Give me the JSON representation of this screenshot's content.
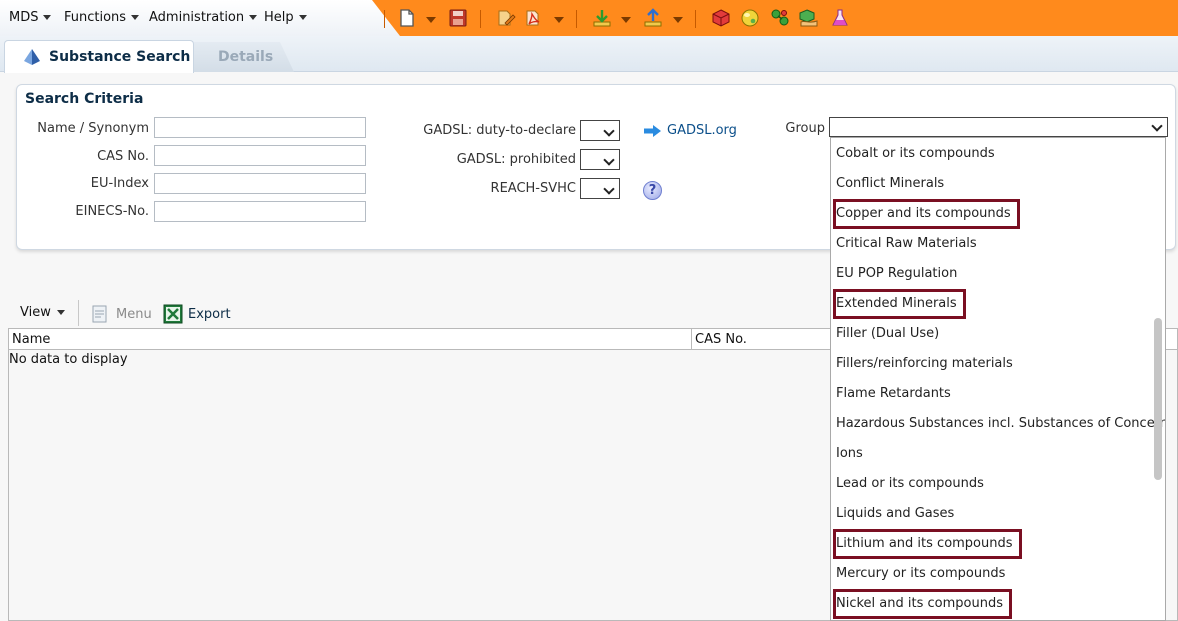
{
  "menubar": {
    "items": [
      "MDS",
      "Functions",
      "Administration",
      "Help"
    ]
  },
  "toolbar_icons": [
    "new-document-icon",
    "save-icon",
    "edit-document-icon",
    "pdf-export-icon",
    "download-icon",
    "upload-icon",
    "red-cube-icon",
    "yellow-sphere-icon",
    "green-molecule-icon",
    "hand-cube-icon",
    "flask-icon"
  ],
  "tabs": {
    "active": "Substance Search",
    "inactive": "Details"
  },
  "search_criteria": {
    "title": "Search Criteria",
    "name_label": "Name / Synonym",
    "name_value": "",
    "cas_label": "CAS No.",
    "cas_value": "",
    "eu_label": "EU-Index",
    "eu_value": "",
    "einecs_label": "EINECS-No.",
    "einecs_value": "",
    "gadsl_duty_label": "GADSL: duty-to-declare",
    "gadsl_prohibited_label": "GADSL: prohibited",
    "reach_label": "REACH-SVHC",
    "gadsl_link": "GADSL.org",
    "help_glyph": "?",
    "group_label": "Group"
  },
  "results": {
    "view_label": "View",
    "menu_label": "Menu",
    "export_label": "Export",
    "columns": [
      "Name",
      "CAS No."
    ],
    "empty_text": "No data to display"
  },
  "group_dropdown": {
    "items": [
      {
        "label": "Cobalt or its compounds",
        "highlighted": false
      },
      {
        "label": "Conflict Minerals",
        "highlighted": false
      },
      {
        "label": "Copper and its compounds",
        "highlighted": true
      },
      {
        "label": "Critical Raw Materials",
        "highlighted": false
      },
      {
        "label": "EU POP Regulation",
        "highlighted": false
      },
      {
        "label": "Extended Minerals",
        "highlighted": true
      },
      {
        "label": "Filler (Dual Use)",
        "highlighted": false
      },
      {
        "label": "Fillers/reinforcing materials",
        "highlighted": false
      },
      {
        "label": "Flame Retardants",
        "highlighted": false
      },
      {
        "label": "Hazardous Substances incl. Substances of Concern",
        "highlighted": false
      },
      {
        "label": "Ions",
        "highlighted": false
      },
      {
        "label": "Lead or its compounds",
        "highlighted": false
      },
      {
        "label": "Liquids and Gases",
        "highlighted": false
      },
      {
        "label": "Lithium and its compounds",
        "highlighted": true
      },
      {
        "label": "Mercury or its compounds",
        "highlighted": false
      },
      {
        "label": "Nickel and its compounds",
        "highlighted": true
      }
    ],
    "highlight_color": "#7a0f22"
  },
  "colors": {
    "accent_orange": "#ff8a1c",
    "title_navy": "#0d2d47",
    "link_blue": "#0b4f8a"
  }
}
